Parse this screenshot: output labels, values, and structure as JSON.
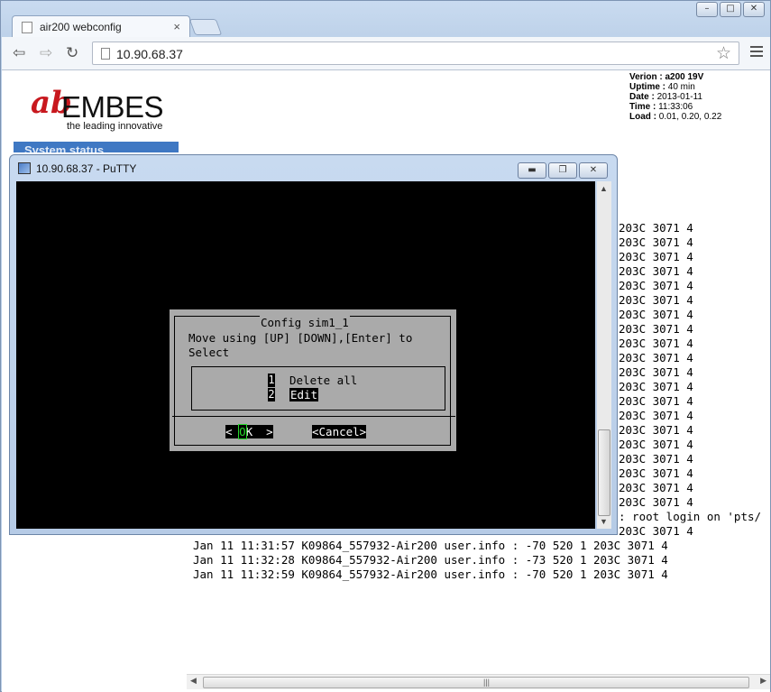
{
  "browser": {
    "tab_title": "air200 webconfig",
    "tab_close": "×",
    "url": "10.90.68.37",
    "window_controls": [
      "–",
      "□",
      "✕"
    ]
  },
  "page": {
    "logo_word": "EMBES",
    "logo_tagline": "the leading innovative",
    "status": {
      "version_label": "Verion :",
      "version_value": "a200 19V",
      "uptime_label": "Uptime :",
      "uptime_value": "40 min",
      "date_label": "Date :",
      "date_value": "2013-01-11",
      "time_label": "Time :",
      "time_value": "11:33:06",
      "load_label": "Load :",
      "load_value": "0.01, 0.20, 0.22"
    },
    "nav_system_status": "System status",
    "log_right": "203C 3071 4\n203C 3071 4\n203C 3071 4\n203C 3071 4\n203C 3071 4\n203C 3071 4\n203C 3071 4\n203C 3071 4\n203C 3071 4\n203C 3071 4\n203C 3071 4\n203C 3071 4\n203C 3071 4\n203C 3071 4\n203C 3071 4\n203C 3071 4\n203C 3071 4\n203C 3071 4\n203C 3071 4\n203C 3071 4\n: root login on 'pts/\n203C 3071 4",
    "log_bottom": "Jan 11 11:31:57 K09864_557932-Air200 user.info : -70 520 1 203C 3071 4\nJan 11 11:32:28 K09864_557932-Air200 user.info : -73 520 1 203C 3071 4\nJan 11 11:32:59 K09864_557932-Air200 user.info : -70 520 1 203C 3071 4"
  },
  "putty": {
    "title": "10.90.68.37 - PuTTY",
    "controls": [
      "▬",
      "❐",
      "✕"
    ],
    "dialog": {
      "title": "Config sim1_1",
      "message": "Move using [UP] [DOWN],[Enter] to\nSelect",
      "items": [
        {
          "num": "1",
          "label": "Delete all"
        },
        {
          "num": "2",
          "label": "Edit"
        }
      ],
      "ok_left": "< ",
      "ok_cursor": "O",
      "ok_right": "K  >",
      "cancel": "<Cancel>"
    }
  }
}
